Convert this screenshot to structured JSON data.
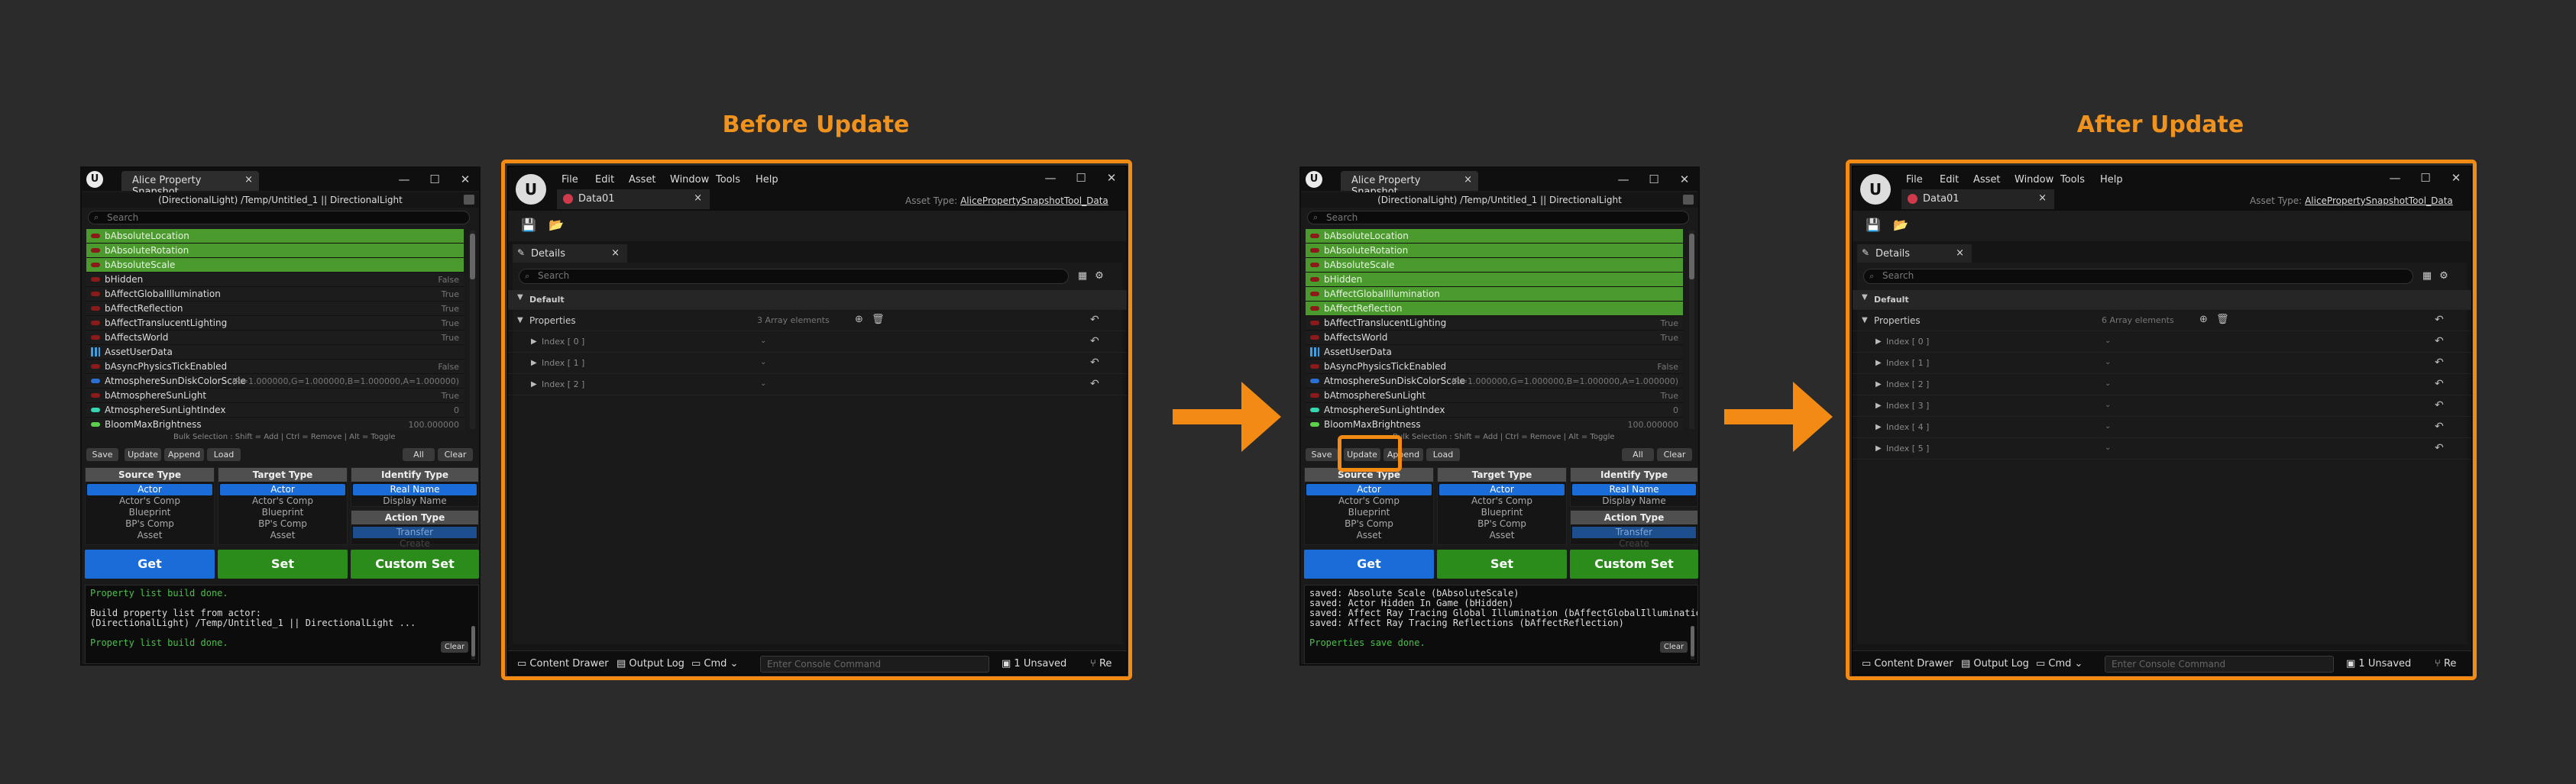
{
  "headings": {
    "before": "Before Update",
    "after": "After Update"
  },
  "tool": {
    "tab_title": "Alice Property Snapshot...",
    "path": "(DirectionalLight) /Temp/Untitled_1 || DirectionalLight",
    "search_placeholder": "Search",
    "rows_before": [
      {
        "name": "bAbsoluteLocation",
        "value": "",
        "sel": true,
        "icon": "bool"
      },
      {
        "name": "bAbsoluteRotation",
        "value": "",
        "sel": true,
        "icon": "bool"
      },
      {
        "name": "bAbsoluteScale",
        "value": "",
        "sel": true,
        "icon": "bool"
      },
      {
        "name": "bHidden",
        "value": "False",
        "sel": false,
        "icon": "bool"
      },
      {
        "name": "bAffectGlobalIllumination",
        "value": "True",
        "sel": false,
        "icon": "bool"
      },
      {
        "name": "bAffectReflection",
        "value": "True",
        "sel": false,
        "icon": "bool"
      },
      {
        "name": "bAffectTranslucentLighting",
        "value": "True",
        "sel": false,
        "icon": "bool"
      },
      {
        "name": "bAffectsWorld",
        "value": "True",
        "sel": false,
        "icon": "bool"
      },
      {
        "name": "AssetUserData",
        "value": "",
        "sel": false,
        "icon": "grid"
      },
      {
        "name": "bAsyncPhysicsTickEnabled",
        "value": "False",
        "sel": false,
        "icon": "bool"
      },
      {
        "name": "AtmosphereSunDiskColorScale",
        "value": "(R=1.000000,G=1.000000,B=1.000000,A=1.000000)",
        "sel": false,
        "icon": "struct"
      },
      {
        "name": "bAtmosphereSunLight",
        "value": "True",
        "sel": false,
        "icon": "bool"
      },
      {
        "name": "AtmosphereSunLightIndex",
        "value": "0",
        "sel": false,
        "icon": "int"
      },
      {
        "name": "BloomMaxBrightness",
        "value": "100.000000",
        "sel": false,
        "icon": "float"
      }
    ],
    "rows_after": [
      {
        "name": "bAbsoluteLocation",
        "value": "",
        "sel": true,
        "icon": "bool"
      },
      {
        "name": "bAbsoluteRotation",
        "value": "",
        "sel": true,
        "icon": "bool"
      },
      {
        "name": "bAbsoluteScale",
        "value": "",
        "sel": true,
        "icon": "bool"
      },
      {
        "name": "bHidden",
        "value": "",
        "sel": true,
        "icon": "bool"
      },
      {
        "name": "bAffectGlobalIllumination",
        "value": "",
        "sel": true,
        "icon": "bool"
      },
      {
        "name": "bAffectReflection",
        "value": "",
        "sel": true,
        "icon": "bool"
      },
      {
        "name": "bAffectTranslucentLighting",
        "value": "True",
        "sel": false,
        "icon": "bool"
      },
      {
        "name": "bAffectsWorld",
        "value": "True",
        "sel": false,
        "icon": "bool"
      },
      {
        "name": "AssetUserData",
        "value": "",
        "sel": false,
        "icon": "grid"
      },
      {
        "name": "bAsyncPhysicsTickEnabled",
        "value": "False",
        "sel": false,
        "icon": "bool"
      },
      {
        "name": "AtmosphereSunDiskColorScale",
        "value": "(R=1.000000,G=1.000000,B=1.000000,A=1.000000)",
        "sel": false,
        "icon": "struct"
      },
      {
        "name": "bAtmosphereSunLight",
        "value": "True",
        "sel": false,
        "icon": "bool"
      },
      {
        "name": "AtmosphereSunLightIndex",
        "value": "0",
        "sel": false,
        "icon": "int"
      },
      {
        "name": "BloomMaxBrightness",
        "value": "100.000000",
        "sel": false,
        "icon": "float"
      }
    ],
    "hint": "Bulk Selection : Shift = Add | Ctrl = Remove | Alt = Toggle",
    "buttons": {
      "save": "Save",
      "update": "Update",
      "append": "Append",
      "load": "Load",
      "all": "All",
      "clear": "Clear"
    },
    "source_type": {
      "title": "Source Type",
      "options": [
        "Actor",
        "Actor's Comp",
        "Blueprint",
        "BP's Comp",
        "Asset"
      ]
    },
    "target_type": {
      "title": "Target Type",
      "options": [
        "Actor",
        "Actor's Comp",
        "Blueprint",
        "BP's Comp",
        "Asset"
      ]
    },
    "identify_type": {
      "title": "Identify Type",
      "options": [
        "Real Name",
        "Display Name"
      ]
    },
    "action_type": {
      "title": "Action Type",
      "options": [
        "Transfer",
        "Create"
      ]
    },
    "get": "Get",
    "set": "Set",
    "custom_set": "Custom Set",
    "log_before": [
      {
        "t": "Property list build done.",
        "c": "g"
      },
      {
        "t": "",
        "c": ""
      },
      {
        "t": "Build property list from actor:",
        "c": ""
      },
      {
        "t": "(DirectionalLight) /Temp/Untitled_1 || DirectionalLight ...",
        "c": ""
      },
      {
        "t": "",
        "c": ""
      },
      {
        "t": "Property list build done.",
        "c": "g"
      }
    ],
    "log_after": [
      {
        "t": "saved: Absolute Scale (bAbsoluteScale)",
        "c": ""
      },
      {
        "t": "saved: Actor Hidden In Game (bHidden)",
        "c": ""
      },
      {
        "t": "saved: Affect Ray Tracing Global Illumination (bAffectGlobalIllumination)",
        "c": ""
      },
      {
        "t": "saved: Affect Ray Tracing Reflections (bAffectReflection)",
        "c": ""
      },
      {
        "t": "",
        "c": ""
      },
      {
        "t": "Properties save done.",
        "c": "g"
      }
    ],
    "log_clear": "Clear"
  },
  "editor": {
    "menus": [
      "File",
      "Edit",
      "Asset",
      "Window",
      "Tools",
      "Help"
    ],
    "asset_tab": "Data01",
    "asset_type_label": "Asset Type:",
    "asset_type_value": "AlicePropertySnapshotTool_Data",
    "details_tab": "Details",
    "search_placeholder": "Search",
    "category": "Default",
    "properties_label": "Properties",
    "before_count": "3 Array elements",
    "after_count": "6 Array elements",
    "before_indices": [
      "Index [ 0 ]",
      "Index [ 1 ]",
      "Index [ 2 ]"
    ],
    "after_indices": [
      "Index [ 0 ]",
      "Index [ 1 ]",
      "Index [ 2 ]",
      "Index [ 3 ]",
      "Index [ 4 ]",
      "Index [ 5 ]"
    ],
    "content_drawer": "Content Drawer",
    "output_log": "Output Log",
    "cmd": "Cmd",
    "console_placeholder": "Enter Console Command",
    "unsaved": "1 Unsaved",
    "revision": "Re"
  },
  "colors": {
    "accent": "#f28a14",
    "selected_row": "#4a9a2e",
    "get": "#1a6cd8",
    "set": "#2b8c1c",
    "custom_set": "#2b8c1c"
  }
}
